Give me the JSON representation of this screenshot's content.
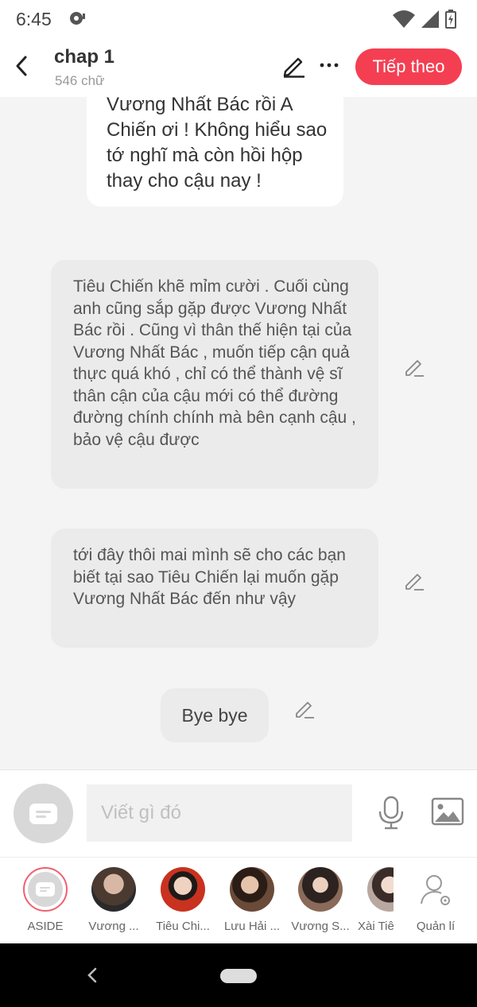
{
  "status_bar": {
    "time": "6:45"
  },
  "header": {
    "title": "chap 1",
    "subtitle": "546 chữ",
    "next_label": "Tiếp theo"
  },
  "messages": [
    {
      "text": "Vương Nhất Bác rồi A Chiến ơi ! Không hiểu sao tớ nghĩ mà còn hồi hộp thay cho cậu nay !"
    },
    {
      "text": "Tiêu Chiến khẽ mỉm cười . Cuối cùng anh cũng sắp gặp được Vương Nhất Bác rồi . Cũng vì thân thế hiện tại của Vương Nhất Bác , muốn tiếp cận quả thực quá khó , chỉ có thể thành vệ sĩ thân cận của cậu mới có thể đường đường chính chính mà bên cạnh cậu , bảo vệ cậu được"
    },
    {
      "text": "tới đây thôi mai mình sẽ cho các bạn biết tại sao Tiêu Chiến lại muốn gặp Vương Nhất Bác đến như vậy"
    },
    {
      "text": "Bye bye"
    }
  ],
  "input": {
    "placeholder": "Viết gì đó"
  },
  "characters": [
    {
      "name": "ASIDE",
      "color": "#d8d8d8"
    },
    {
      "name": "Vương ...",
      "color": "#5a4a3e"
    },
    {
      "name": "Tiêu Chi...",
      "color": "#c23a2a"
    },
    {
      "name": "Lưu Hải ...",
      "color": "#3d2b22"
    },
    {
      "name": "Vương S...",
      "color": "#6b5040"
    },
    {
      "name": "Xài Tiê",
      "color": "#a89890"
    },
    {
      "name": "Quản lí",
      "color": "#9a9a9a"
    }
  ],
  "colors": {
    "accent": "#f43f52",
    "bubble": "#ebebeb"
  }
}
